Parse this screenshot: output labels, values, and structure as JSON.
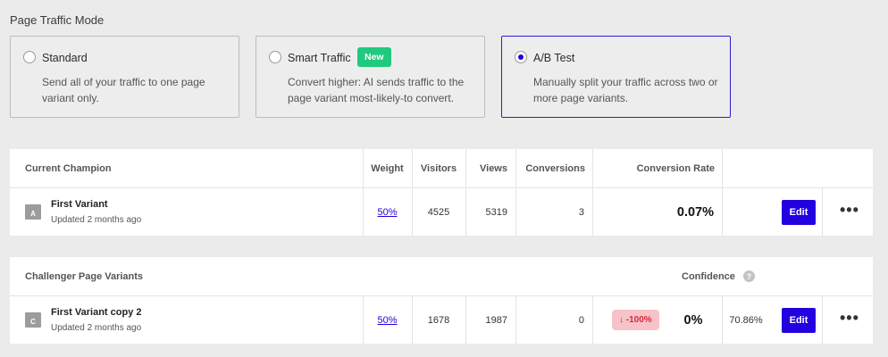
{
  "section_title": "Page Traffic Mode",
  "modes": [
    {
      "title": "Standard",
      "desc": "Send all of your traffic to one page variant only.",
      "selected": false
    },
    {
      "title": "Smart Traffic",
      "badge": "New",
      "desc": "Convert higher: AI sends traffic to the page variant most-likely-to convert.",
      "selected": false
    },
    {
      "title": "A/B Test",
      "desc": "Manually split your traffic across two or more page variants.",
      "selected": true
    }
  ],
  "champion": {
    "headers": {
      "name": "Current Champion",
      "weight": "Weight",
      "visitors": "Visitors",
      "views": "Views",
      "conversions": "Conversions",
      "rate": "Conversion Rate"
    },
    "row": {
      "letter": "A",
      "name": "First Variant",
      "updated": "Updated 2 months ago",
      "weight": "50%",
      "visitors": "4525",
      "views": "5319",
      "conversions": "3",
      "rate": "0.07%",
      "edit": "Edit",
      "more": "•••"
    }
  },
  "challengers": {
    "headers": {
      "name": "Challenger Page Variants",
      "confidence": "Confidence",
      "help": "?"
    },
    "row": {
      "letter": "C",
      "name": "First Variant copy 2",
      "updated": "Updated 2 months ago",
      "weight": "50%",
      "visitors": "1678",
      "views": "1987",
      "conversions": "0",
      "delta": "-100%",
      "delta_arrow": "↓",
      "rate": "0%",
      "confidence": "70.86%",
      "edit": "Edit",
      "more": "•••"
    }
  },
  "colors": {
    "accent": "#2200e0",
    "new_badge": "#1fc97e",
    "delta_bg": "#f7c3c8",
    "delta_text": "#d22a3a"
  }
}
